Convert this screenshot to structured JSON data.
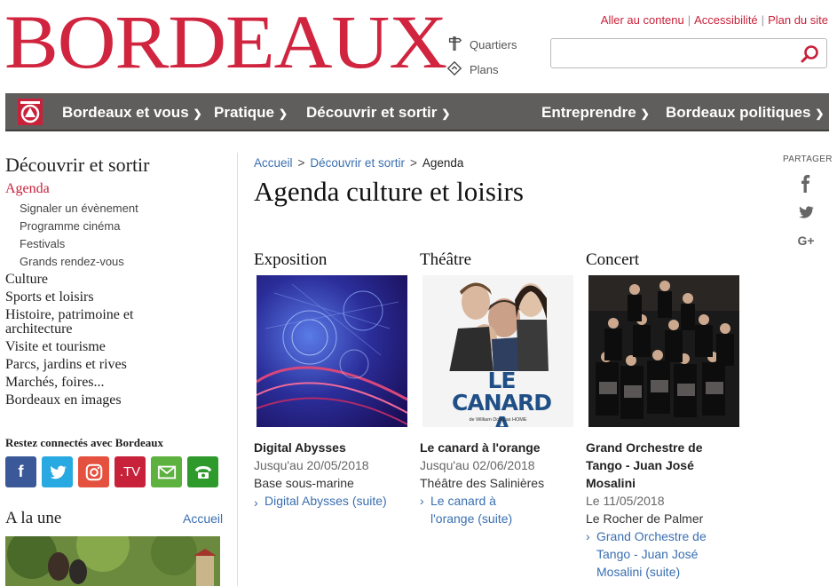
{
  "header": {
    "logo_text": "BORDEAUX",
    "quick_links": [
      {
        "label": "Quartiers",
        "icon": "signpost-icon"
      },
      {
        "label": "Plans",
        "icon": "diamond-arrow-icon"
      }
    ],
    "top_links": [
      "Aller au contenu",
      "Accessibilité",
      "Plan du site"
    ],
    "search_placeholder": ""
  },
  "nav": {
    "home_icon": "bordeaux-emblem-icon",
    "items": [
      {
        "label": "Bordeaux et vous"
      },
      {
        "label": "Pratique"
      },
      {
        "label": "Découvrir et sortir"
      },
      {
        "label": "Entreprendre"
      },
      {
        "label": "Bordeaux politiques"
      }
    ]
  },
  "sidebar": {
    "title": "Découvrir et sortir",
    "active": "Agenda",
    "sub_items": [
      "Signaler un évènement",
      "Programme cinéma",
      "Festivals",
      "Grands rendez-vous"
    ],
    "items": [
      "Culture",
      "Sports et loisirs",
      "Histoire, patrimoine et architecture",
      "Visite et tourisme",
      "Parcs, jardins et rives",
      "Marchés, foires...",
      "Bordeaux en images"
    ],
    "connect_title": "Restez connectés avec Bordeaux",
    "socials": [
      {
        "name": "facebook-icon",
        "glyph": "f",
        "color": "#3b5998"
      },
      {
        "name": "twitter-icon",
        "glyph": "🐦",
        "color": "#29a9e1"
      },
      {
        "name": "instagram-icon",
        "glyph": "◎",
        "color": "#e4513f"
      },
      {
        "name": "tv-icon",
        "glyph": ".TV",
        "color": "#c8213a"
      },
      {
        "name": "newsletter-icon",
        "glyph": "✉",
        "color": "#5db13f"
      },
      {
        "name": "phone-icon",
        "glyph": "☎",
        "color": "#2f9a2c"
      }
    ],
    "alaune_title": "A la une",
    "alaune_link": "Accueil"
  },
  "main": {
    "breadcrumb": [
      "Accueil",
      "Découvrir et sortir",
      "Agenda"
    ],
    "title": "Agenda culture et loisirs",
    "cards": [
      {
        "category": "Exposition",
        "name": "Digital Abysses",
        "date": "Jusqu'au 20/05/2018",
        "place": "Base sous-marine",
        "more": "Digital Abysses (suite)"
      },
      {
        "category": "Théâtre",
        "name": "Le canard à l'orange",
        "date": "Jusqu'au 02/06/2018",
        "place": "Théâtre des Salinières",
        "more": "Le canard à l'orange (suite)",
        "poster_line1": "LE CANARD",
        "poster_line2": "A L'ORANGE",
        "poster_credit": "de William Douglas HOME"
      },
      {
        "category": "Concert",
        "name": "Grand Orchestre de Tango - Juan José Mosalini",
        "date": "Le 11/05/2018",
        "place": "Le Rocher de Palmer",
        "more": "Grand Orchestre de Tango - Juan José Mosalini (suite)"
      }
    ]
  },
  "share": {
    "label": "PARTAGER",
    "items": [
      "facebook-icon",
      "twitter-icon",
      "google-plus-icon"
    ]
  },
  "colors": {
    "brand_red": "#c8213a",
    "nav_bg": "#5f5e5c",
    "link_blue": "#3a6fb0"
  }
}
